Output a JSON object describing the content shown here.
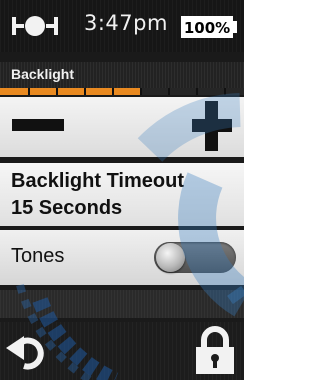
{
  "status_bar": {
    "time": "3:47pm",
    "battery_label": "100%",
    "battery_level_percent": 100,
    "satellite_icon": "satellite-icon"
  },
  "backlight": {
    "title": "Backlight",
    "level_fraction": 0.58,
    "level_color": "#e98a21",
    "decrease_icon": "minus-icon",
    "increase_icon": "plus-icon"
  },
  "timeout": {
    "label": "Backlight Timeout",
    "value": "15 Seconds"
  },
  "tones": {
    "label": "Tones",
    "enabled": false
  },
  "bottom_bar": {
    "back_icon": "back-arrow-icon",
    "lock_icon": "lock-icon"
  },
  "colors": {
    "accent": "#e98a21",
    "watermark": "#3a7fc0"
  }
}
